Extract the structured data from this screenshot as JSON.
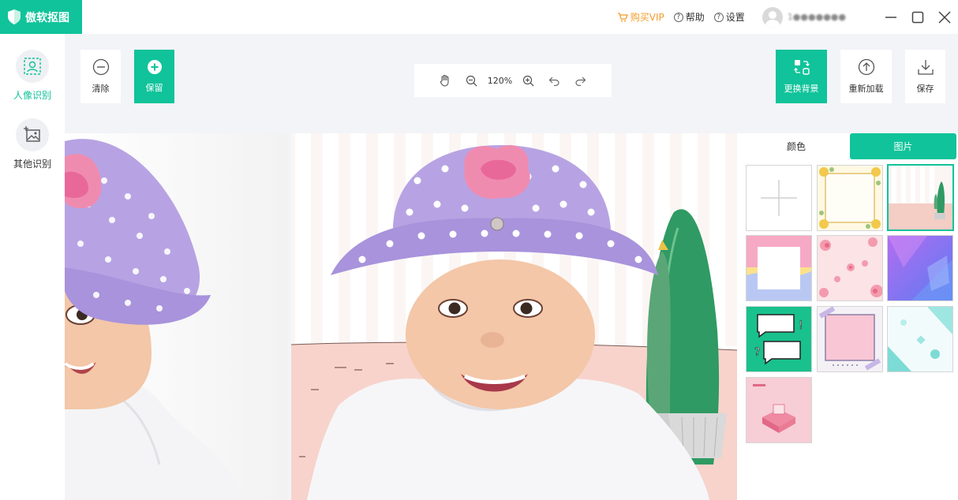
{
  "app": {
    "title": "傲软抠图"
  },
  "header": {
    "vip_label": "购买VIP",
    "help_label": "帮助",
    "settings_label": "设置",
    "username": "1●●●●●●●"
  },
  "sidebar": {
    "items": [
      {
        "label": "人像识别",
        "active": true
      },
      {
        "label": "其他识别",
        "active": false
      }
    ]
  },
  "toolbar": {
    "clear_label": "清除",
    "keep_label": "保留",
    "zoom": "120%",
    "change_bg_label": "更换背景",
    "reload_label": "重新加载",
    "save_label": "保存"
  },
  "panel": {
    "tabs": [
      {
        "label": "颜色",
        "active": false
      },
      {
        "label": "图片",
        "active": true
      }
    ],
    "thumbnails": [
      "add-image",
      "floral-frame",
      "cactus-room",
      "pastel-frame",
      "pink-flowers",
      "purple-geometric",
      "speech-bubbles",
      "pink-tape-frame",
      "teal-shapes",
      "pink-podium"
    ],
    "selected_index": 2
  },
  "colors": {
    "accent": "#10c39a",
    "vip": "#f39c2b"
  }
}
